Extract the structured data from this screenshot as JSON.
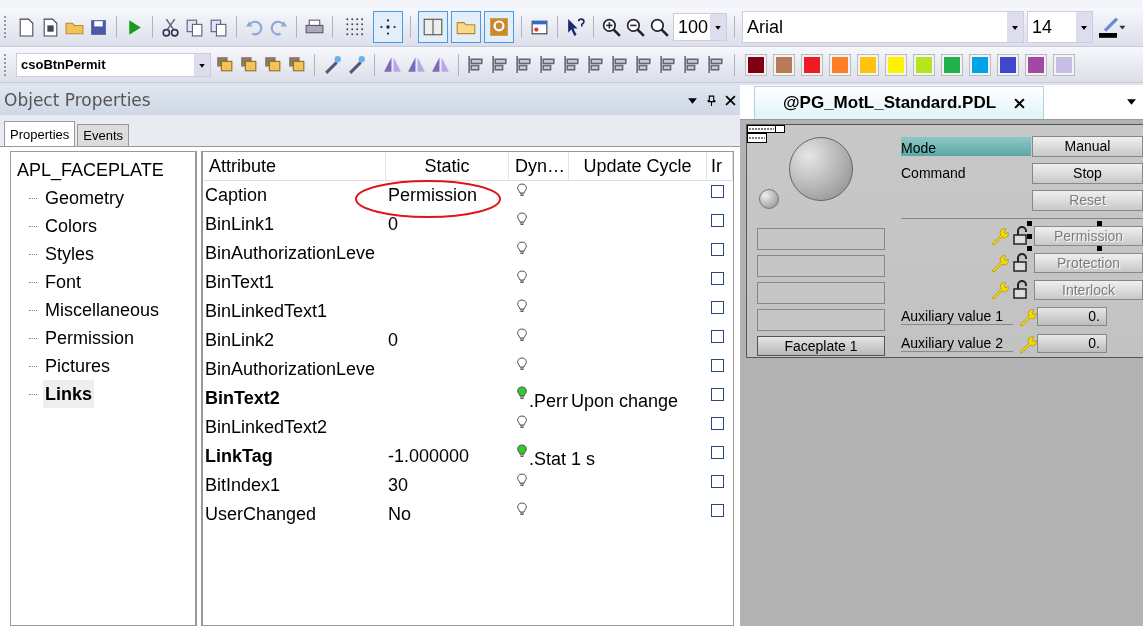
{
  "toolbar": {
    "toggles": [
      {
        "on": false
      },
      {
        "on": true
      },
      {
        "on": true
      },
      {
        "on": true
      },
      {
        "on": true
      }
    ],
    "zoom": "100",
    "font": "Arial",
    "font_size": "14"
  },
  "object_combo": "csoBtnPermit",
  "palette": [
    {
      "color": "#7f0013"
    },
    {
      "color": "#b97a57"
    },
    {
      "color": "#ed1c24"
    },
    {
      "color": "#ff7f27"
    },
    {
      "color": "#ffc20e"
    },
    {
      "color": "#fff200"
    },
    {
      "color": "#b5e61d"
    },
    {
      "color": "#22b14c"
    },
    {
      "color": "#00a2e8"
    },
    {
      "color": "#3f48cc"
    },
    {
      "color": "#a349a4"
    },
    {
      "color": "#c8bfe7"
    }
  ],
  "properties_panel": {
    "title": "Object Properties",
    "tabs": [
      {
        "label": "Properties",
        "selected": true
      },
      {
        "label": "Events",
        "selected": false
      }
    ],
    "tree": {
      "label": "APL_FACEPLATE",
      "children": [
        {
          "label": "Geometry",
          "selected": false
        },
        {
          "label": "Colors",
          "selected": false
        },
        {
          "label": "Styles",
          "selected": false
        },
        {
          "label": "Font",
          "selected": false
        },
        {
          "label": "Miscellaneous",
          "selected": false
        },
        {
          "label": "Permission",
          "selected": false
        },
        {
          "label": "Pictures",
          "selected": false
        },
        {
          "label": "Links",
          "selected": true
        }
      ]
    },
    "table": {
      "columns": [
        "Attribute",
        "Static",
        "Dyn…",
        "Update Cycle",
        "Ir"
      ],
      "rows": [
        {
          "attribute": "Caption",
          "static": "Permission",
          "dynamic": false,
          "indirect": false
        },
        {
          "attribute": "BinLink1",
          "static": "0",
          "dynamic": false,
          "indirect": false
        },
        {
          "attribute": "BinAuthorizationLeve",
          "dynamic": false,
          "indirect": false
        },
        {
          "attribute": "BinText1",
          "dynamic": false,
          "indirect": false
        },
        {
          "attribute": "BinLinkedText1",
          "dynamic": false,
          "indirect": false
        },
        {
          "attribute": "BinLink2",
          "static": "0",
          "dynamic": false,
          "indirect": false
        },
        {
          "attribute": "BinAuthorizationLeve",
          "dynamic": false,
          "indirect": false
        },
        {
          "attribute": "BinText2",
          "dynamic": true,
          "dynamic_text": ".Perr",
          "update_cycle": "Upon change",
          "indirect": false
        },
        {
          "attribute": "BinLinkedText2",
          "dynamic": false,
          "indirect": false
        },
        {
          "attribute": "LinkTag",
          "static": "-1.000000",
          "dynamic": true,
          "dynamic_text": ".Stat",
          "update_cycle": "1 s",
          "indirect": false
        },
        {
          "attribute": "BitIndex1",
          "static": "30",
          "dynamic": false,
          "indirect": false
        },
        {
          "attribute": "UserChanged",
          "static": "No",
          "dynamic": false,
          "indirect": false
        }
      ]
    }
  },
  "document_tab": "@PG_MotL_Standard.PDL",
  "faceplate": {
    "mode_label": "Mode",
    "mode_value": "Manual",
    "command_label": "Command",
    "command_value": "Stop",
    "reset": {
      "label": "Reset",
      "disabled": true
    },
    "locks": [
      {
        "label": "Permission",
        "disabled": true,
        "selected": true
      },
      {
        "label": "Protection",
        "disabled": true,
        "selected": false
      },
      {
        "label": "Interlock",
        "disabled": true,
        "selected": false
      }
    ],
    "aux": [
      {
        "label": "Auxiliary value 1",
        "value": "0."
      },
      {
        "label": "Auxiliary value 2",
        "value": "0."
      }
    ],
    "button": "Faceplate 1"
  }
}
